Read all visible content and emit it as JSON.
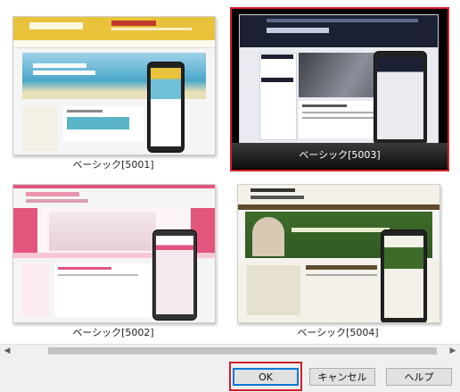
{
  "templates": [
    {
      "label": "ベーシック[5001]",
      "selected": false,
      "accent": "#e8c23a"
    },
    {
      "label": "ベーシック[5003]",
      "selected": true,
      "accent": "#1b2033"
    },
    {
      "label": "ベーシック[5002]",
      "selected": false,
      "accent": "#e2557d"
    },
    {
      "label": "ベーシック[5004]",
      "selected": false,
      "accent": "#3f6b2a"
    }
  ],
  "buttons": {
    "ok": "OK",
    "cancel": "キャンセル",
    "help": "ヘルプ"
  },
  "scrollbar": {
    "left_arrow": "◀",
    "right_arrow": "▶"
  },
  "colors": {
    "selection_border": "#d0202a",
    "focus_border": "#d0202a",
    "button_face": "#e1e1e1"
  }
}
